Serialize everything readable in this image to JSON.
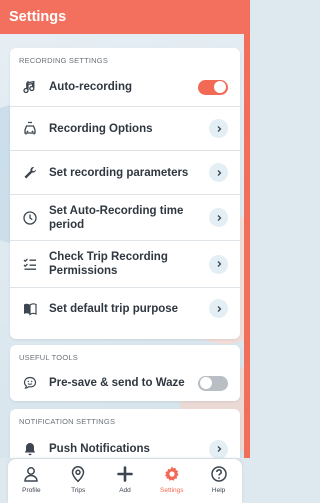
{
  "header": {
    "title": "Settings"
  },
  "colors": {
    "accent": "#f26a55",
    "header": "#f2705d",
    "toggle_off": "#b8bec3"
  },
  "sections": {
    "recording": {
      "title": "RECORDING SETTINGS",
      "items": [
        {
          "label": "Auto-recording",
          "icon": "note-icon",
          "control": "toggle",
          "toggle_on": true
        },
        {
          "label": "Recording Options",
          "icon": "car-icon",
          "control": "chevron"
        },
        {
          "label": "Set recording parameters",
          "icon": "wrench-icon",
          "control": "chevron"
        },
        {
          "label": "Set Auto-Recording time period",
          "icon": "clock-icon",
          "control": "chevron"
        },
        {
          "label": "Check Trip Recording Permissions",
          "icon": "checklist-icon",
          "control": "chevron"
        },
        {
          "label": "Set default trip purpose",
          "icon": "book-icon",
          "control": "chevron"
        }
      ]
    },
    "tools": {
      "title": "USEFUL TOOLS",
      "items": [
        {
          "label": "Pre-save & send to Waze",
          "icon": "waze-icon",
          "control": "toggle",
          "toggle_on": false
        }
      ]
    },
    "notifications": {
      "title": "NOTIFICATION SETTINGS",
      "items": [
        {
          "label": "Push Notifications",
          "icon": "bell-icon",
          "control": "chevron"
        }
      ]
    }
  },
  "tabbar": {
    "tabs": [
      {
        "label": "Profile",
        "icon": "person-icon",
        "active": false
      },
      {
        "label": "Trips",
        "icon": "map-pin-icon",
        "active": false
      },
      {
        "label": "Add",
        "icon": "plus-icon",
        "active": false
      },
      {
        "label": "Settings",
        "icon": "gear-icon",
        "active": true
      },
      {
        "label": "Help",
        "icon": "question-icon",
        "active": false
      }
    ]
  }
}
